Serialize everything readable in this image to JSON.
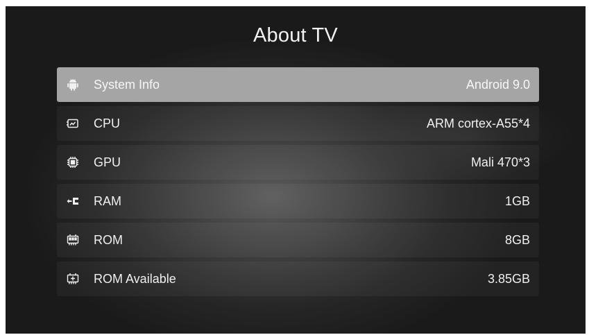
{
  "page": {
    "title": "About TV"
  },
  "items": [
    {
      "label": "System Info",
      "value": "Android 9.0",
      "icon": "android-icon",
      "selected": true
    },
    {
      "label": "CPU",
      "value": "ARM cortex-A55*4",
      "icon": "cpu-icon",
      "selected": false
    },
    {
      "label": "GPU",
      "value": "Mali 470*3",
      "icon": "gpu-chip-icon",
      "selected": false
    },
    {
      "label": "RAM",
      "value": "1GB",
      "icon": "ram-icon",
      "selected": false
    },
    {
      "label": "ROM",
      "value": "8GB",
      "icon": "rom-icon",
      "selected": false
    },
    {
      "label": "ROM Available",
      "value": "3.85GB",
      "icon": "rom-available-icon",
      "selected": false
    }
  ],
  "colors": {
    "selected_row": "#a5a5a5",
    "text": "#f0f0f0",
    "background": "#2a2a2a"
  }
}
